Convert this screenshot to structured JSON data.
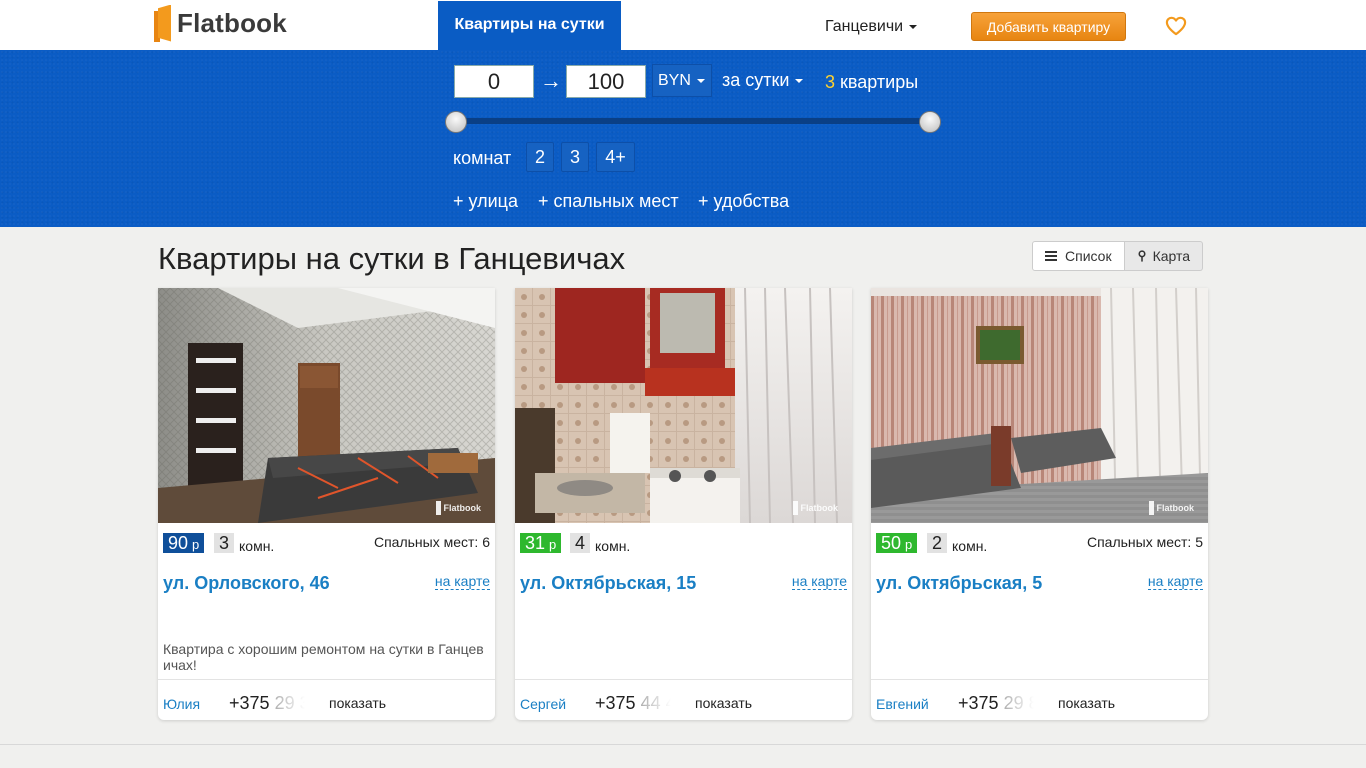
{
  "header": {
    "logo_text": "Flatbook",
    "nav_active": "Квартиры на сутки",
    "city": "Ганцевичи",
    "add_button": "Добавить квартиру"
  },
  "filter": {
    "price_from": "0",
    "price_to": "100",
    "arrow": "→",
    "currency": "BYN",
    "period": "за сутки",
    "count_number": "3",
    "count_label": "квартиры",
    "rooms_label": "комнат",
    "room_options": [
      "2",
      "3",
      "4+"
    ],
    "extras": [
      "+ улица",
      "+ спальных мест",
      "+ удобства"
    ]
  },
  "main": {
    "title": "Квартиры на сутки в Ганцевичах",
    "view_list": "Список",
    "view_map": "Карта"
  },
  "listings": [
    {
      "price": "90",
      "currency_short": "р",
      "price_color": "#0f4f9a",
      "rooms": "3",
      "rooms_suffix": "комн.",
      "beds": "Спальных мест: 6",
      "street": "ул. Орловского, 46",
      "map_link": "на карте",
      "description": "Квартира с хорошим ремонтом на сутки в Ганцевичах!",
      "owner": "Юлия",
      "phone_visible": "+375",
      "phone_hidden": "29 3",
      "show_label": "показать",
      "watermark": "Flatbook"
    },
    {
      "price": "31",
      "currency_short": "р",
      "price_color": "#2eb82e",
      "rooms": "4",
      "rooms_suffix": "комн.",
      "beds": "",
      "street": "ул. Октябрьская, 15",
      "map_link": "на карте",
      "description": "",
      "owner": "Сергей",
      "phone_visible": "+375",
      "phone_hidden": "44 4",
      "show_label": "показать",
      "watermark": "Flatbook"
    },
    {
      "price": "50",
      "currency_short": "р",
      "price_color": "#2eb82e",
      "rooms": "2",
      "rooms_suffix": "комн.",
      "beds": "Спальных мест: 5",
      "street": "ул. Октябрьская, 5",
      "map_link": "на карте",
      "description": "",
      "owner": "Евгений",
      "phone_visible": "+375",
      "phone_hidden": "29 8",
      "show_label": "показать",
      "watermark": "Flatbook"
    }
  ],
  "colors": {
    "brand_blue": "#0b5cc5",
    "accent_orange": "#f39a1d",
    "link_blue": "#1a7fc4",
    "count_yellow": "#ffd22e"
  }
}
